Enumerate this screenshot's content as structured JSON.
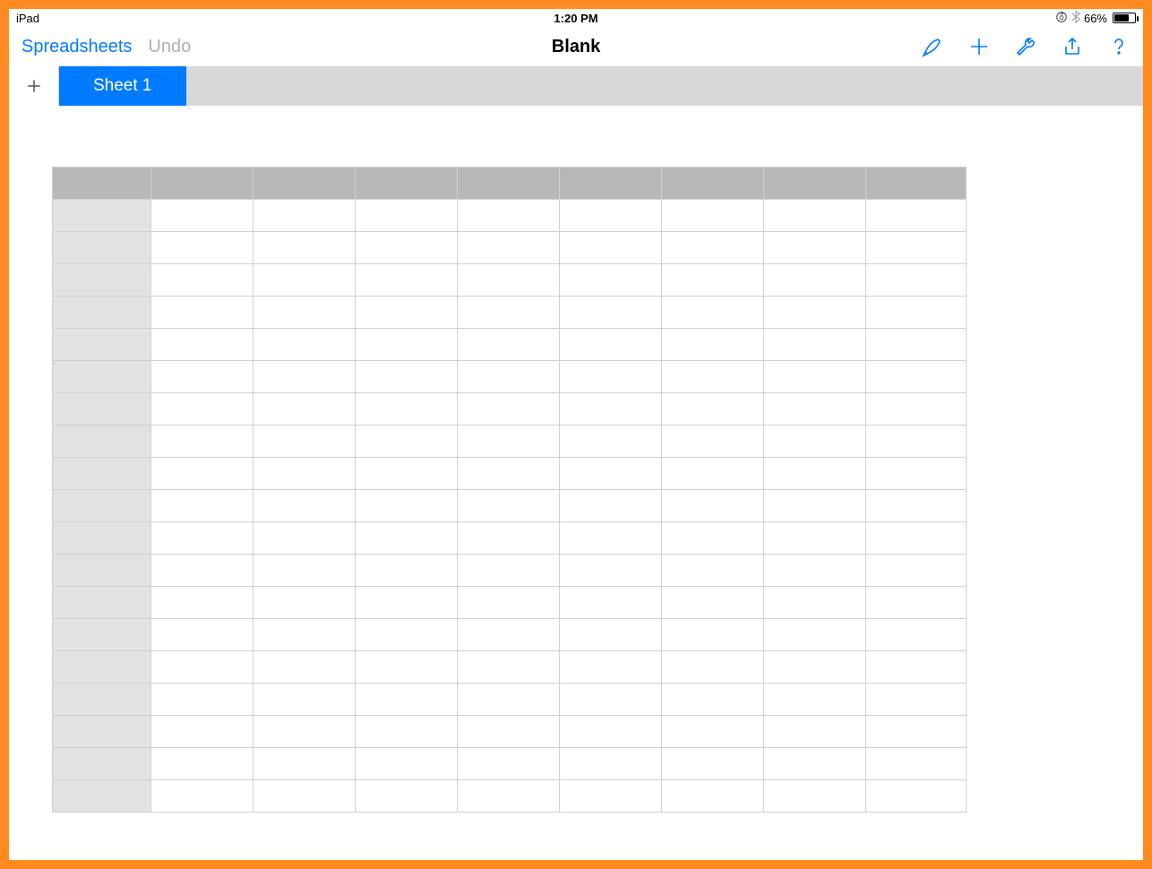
{
  "status": {
    "device": "iPad",
    "time": "1:20 PM",
    "battery_pct": "66%",
    "battery_level": 0.66
  },
  "toolbar": {
    "back_label": "Spreadsheets",
    "undo_label": "Undo",
    "title": "Blank"
  },
  "sheets": {
    "active": "Sheet 1"
  },
  "grid": {
    "columns": 9,
    "rows": 19,
    "cells": []
  }
}
